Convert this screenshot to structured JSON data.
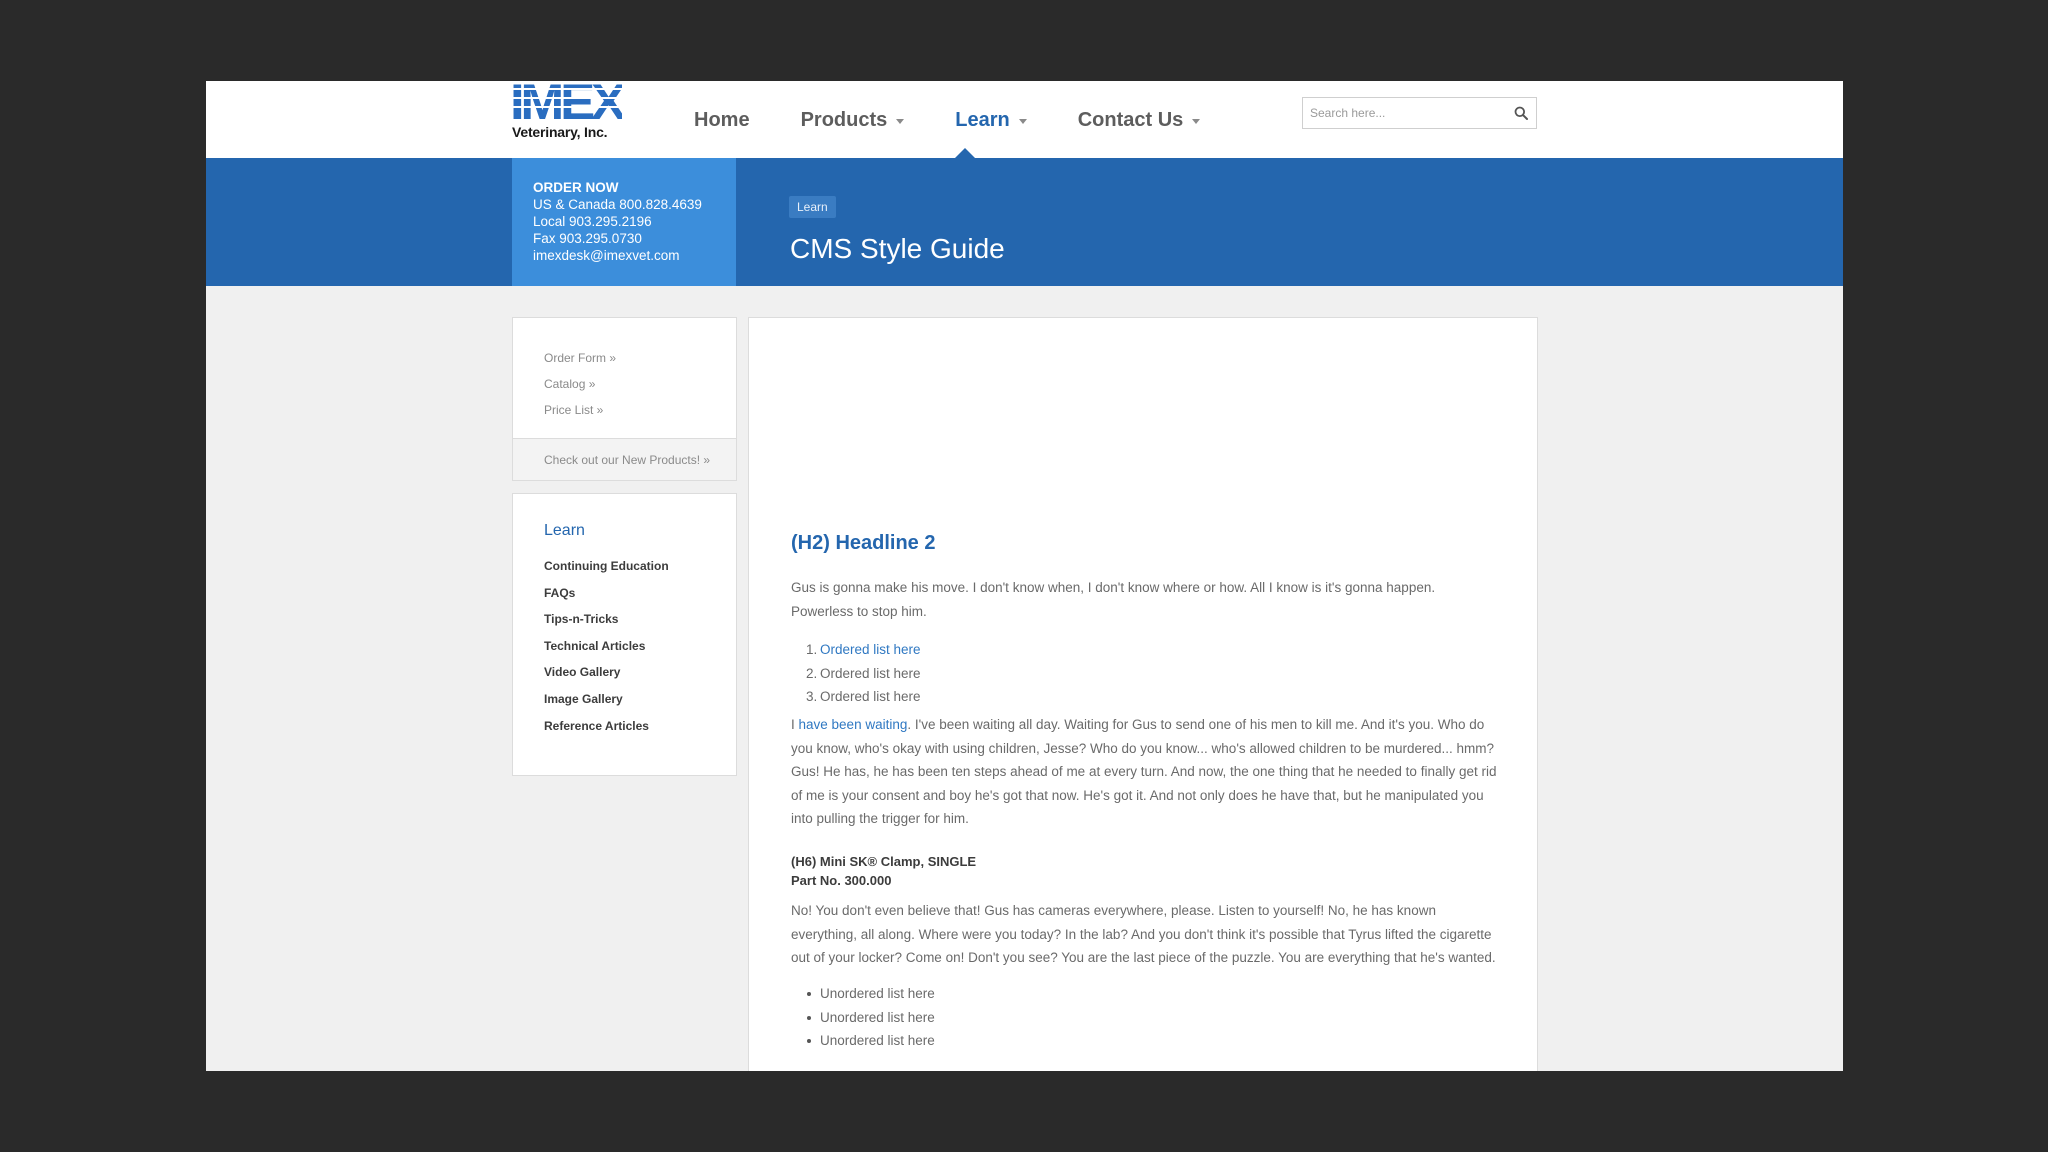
{
  "brand": {
    "logo_text": "IMEX",
    "subtitle": "Veterinary, Inc.",
    "colors": {
      "primary": "#2466ae",
      "accent": "#3c8edb",
      "logo": "#2a6dc0"
    }
  },
  "nav": {
    "items": [
      {
        "label": "Home",
        "dropdown": false,
        "active": false
      },
      {
        "label": "Products",
        "dropdown": true,
        "active": false
      },
      {
        "label": "Learn",
        "dropdown": true,
        "active": true
      },
      {
        "label": "Contact Us",
        "dropdown": true,
        "active": false
      }
    ]
  },
  "search": {
    "placeholder": "Search here...",
    "icon": "search-icon"
  },
  "order": {
    "title": "ORDER NOW",
    "lines": [
      "US & Canada 800.828.4639",
      "Local 903.295.2196",
      "Fax 903.295.0730",
      "imexdesk@imexvet.com"
    ]
  },
  "breadcrumb": "Learn",
  "page_title": "CMS Style Guide",
  "sidebar": {
    "quick_links": [
      "Order Form »",
      "Catalog »",
      "Price List »"
    ],
    "new_products": "Check out our New Products! »",
    "learn_heading": "Learn",
    "learn_items": [
      "Continuing Education",
      "FAQs",
      "Tips-n-Tricks",
      "Technical Articles",
      "Video Gallery",
      "Image Gallery",
      "Reference Articles"
    ]
  },
  "content": {
    "h2": "(H2) Headline 2",
    "p1": "Gus is gonna make his move. I don't know when, I don't know where or how. All I know is it's gonna happen. Powerless to stop him.",
    "ordered": [
      {
        "num": "1.",
        "text": "Ordered list here"
      },
      {
        "num": "2.",
        "text": "Ordered list here"
      },
      {
        "num": "3.",
        "text": "Ordered list here"
      }
    ],
    "p2_prefix": "I ",
    "p2_link": "have been waiting",
    "p2_rest": ". I've been waiting all day. Waiting for Gus to send one of his men to kill me. And it's you. Who do you know, who's okay with using children, Jesse? Who do you know... who's allowed children to be murdered... hmm? Gus! He has, he has been ten steps ahead of me at every turn. And now, the one thing that he needed to finally get rid of me is your consent and boy he's got that now. He's got it. And not only does he have that, but he manipulated you into pulling the trigger for him.",
    "h6_line1": "(H6) Mini SK® Clamp, SINGLE",
    "h6_line2": "Part No. 300.000",
    "p3": "No! You don't even believe that! Gus has cameras everywhere, please. Listen to yourself! No, he has known everything, all along. Where were you today? In the lab? And you don't think it's possible that Tyrus lifted the cigarette out of your locker? Come on! Don't you see? You are the last piece of the puzzle. You are everything that he's wanted.",
    "unordered": [
      "Unordered list here",
      "Unordered list here",
      "Unordered list here"
    ]
  }
}
